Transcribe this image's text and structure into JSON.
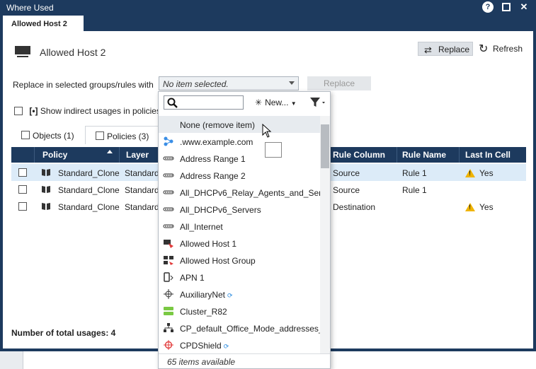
{
  "window": {
    "title": "Where Used",
    "tab": "Allowed Host 2"
  },
  "header": {
    "object_name": "Allowed Host 2",
    "replace_button": "Replace",
    "refresh_button": "Refresh"
  },
  "replace_row": {
    "label": "Replace in selected groups/rules with",
    "combo_value": "No item selected.",
    "replace_button": "Replace"
  },
  "indirect": {
    "bracket": "[•]",
    "label": "Show indirect usages in policies"
  },
  "sub_tabs": [
    {
      "label": "Objects (1)"
    },
    {
      "label": "Policies (3)"
    }
  ],
  "grid": {
    "columns": {
      "policy": "Policy",
      "layer": "Layer",
      "rule_column": "Rule Column",
      "rule_name": "Rule Name",
      "last_in_cell": "Last In Cell"
    },
    "rows": [
      {
        "policy": "Standard_Clone",
        "layer": "Standard_",
        "rule_column": "Source",
        "rule_name": "Rule 1",
        "last_in_cell": "Yes",
        "selected": true
      },
      {
        "policy": "Standard_Clone",
        "layer": "Standard_",
        "rule_column": "Source",
        "rule_name": "Rule 1",
        "last_in_cell": "",
        "selected": false
      },
      {
        "policy": "Standard_Clone",
        "layer": "Standard_",
        "rule_column": "Destination",
        "rule_name": "",
        "last_in_cell": "Yes",
        "selected": false
      }
    ]
  },
  "footer": {
    "total": "Number of total usages: 4"
  },
  "dropdown": {
    "new_label": "New...",
    "items": [
      {
        "label": "None (remove item)",
        "icon": "none",
        "highlight": true
      },
      {
        "label": ".www.example.com",
        "icon": "domain-icon"
      },
      {
        "label": "Address Range 1",
        "icon": "address-range-icon"
      },
      {
        "label": "Address Range 2",
        "icon": "address-range-icon"
      },
      {
        "label": "All_DHCPv6_Relay_Agents_and_Servers",
        "icon": "address-range-icon"
      },
      {
        "label": "All_DHCPv6_Servers",
        "icon": "address-range-icon"
      },
      {
        "label": "All_Internet",
        "icon": "address-range-icon"
      },
      {
        "label": "Allowed Host 1",
        "icon": "host-icon"
      },
      {
        "label": "Allowed Host Group",
        "icon": "group-icon"
      },
      {
        "label": "APN 1",
        "icon": "apn-icon"
      },
      {
        "label": "AuxiliaryNet",
        "icon": "network-icon",
        "sync": true
      },
      {
        "label": "Cluster_R82",
        "icon": "cluster-icon"
      },
      {
        "label": "CP_default_Office_Mode_addresses_p...",
        "icon": "tree-icon"
      },
      {
        "label": "CPDShield",
        "icon": "shield-icon",
        "sync": true
      }
    ],
    "footer": "65 items available"
  },
  "colors": {
    "window_blue": "#1d3a5e",
    "selected_row": "#dcebf8",
    "warning": "#f0b400"
  }
}
